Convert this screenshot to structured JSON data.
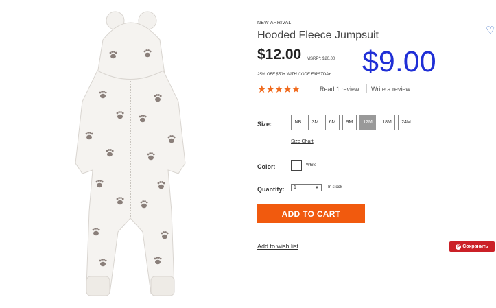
{
  "product": {
    "badge": "NEW ARRIVAL",
    "title": "Hooded Fleece Jumpsuit",
    "price": "$12.00",
    "msrp": "MSRP*: $20.00",
    "promo": "25% OFF $50+ WITH CODE FIRSTDAY",
    "sale_price": "$9.00",
    "stars": "★★★★★",
    "rating": 5,
    "review_link": "Read 1 review",
    "write_review": "Write a review"
  },
  "options": {
    "size_label": "Size:",
    "sizes": [
      "NB",
      "3M",
      "6M",
      "9M",
      "12M",
      "18M",
      "24M"
    ],
    "selected_size": "12M",
    "size_chart": "Size Chart",
    "color_label": "Color:",
    "color_name": "White",
    "color_swatch": "#ffffff",
    "quantity_label": "Quantity:",
    "quantity_value": "1",
    "stock_status": "In stock"
  },
  "actions": {
    "add_to_cart": "ADD TO CART",
    "add_to_wishlist": "Add to wish list",
    "pin_button": "Сохранить",
    "heart_icon": "heart-outline-icon",
    "pin_icon": "pinterest-icon"
  },
  "colors": {
    "accent": "#f15a0e",
    "sale_price": "#1f2fd6",
    "stars": "#f06a1d",
    "pin": "#cb2027"
  }
}
